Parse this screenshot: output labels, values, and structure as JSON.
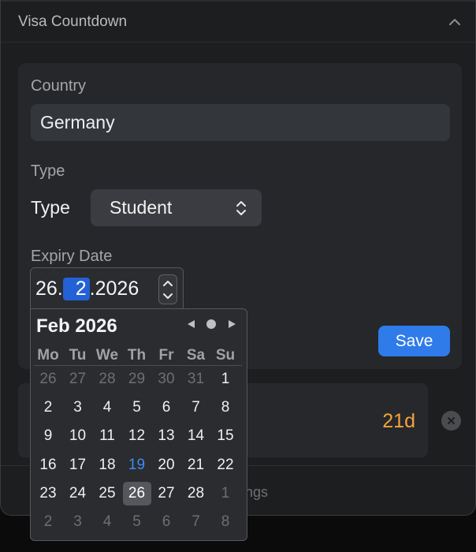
{
  "header": {
    "title": "Visa Countdown"
  },
  "form": {
    "country_label": "Country",
    "country_value": "Germany",
    "type_label": "Type",
    "type_inline_label": "Type",
    "type_value": "Student",
    "expiry_label": "Expiry Date",
    "date": {
      "day": "26.",
      "month": "2",
      "year": ".2026"
    },
    "save_label": "Save"
  },
  "calendar": {
    "title": "Feb 2026",
    "weekdays": [
      "Mo",
      "Tu",
      "We",
      "Th",
      "Fr",
      "Sa",
      "Su"
    ],
    "weeks": [
      [
        {
          "d": "26",
          "k": "dim"
        },
        {
          "d": "27",
          "k": "dim"
        },
        {
          "d": "28",
          "k": "dim"
        },
        {
          "d": "29",
          "k": "dim"
        },
        {
          "d": "30",
          "k": "dim"
        },
        {
          "d": "31",
          "k": "dim"
        },
        {
          "d": "1",
          "k": "norm"
        }
      ],
      [
        {
          "d": "2",
          "k": "norm"
        },
        {
          "d": "3",
          "k": "norm"
        },
        {
          "d": "4",
          "k": "norm"
        },
        {
          "d": "5",
          "k": "norm"
        },
        {
          "d": "6",
          "k": "norm"
        },
        {
          "d": "7",
          "k": "norm"
        },
        {
          "d": "8",
          "k": "norm"
        }
      ],
      [
        {
          "d": "9",
          "k": "norm"
        },
        {
          "d": "10",
          "k": "norm"
        },
        {
          "d": "11",
          "k": "norm"
        },
        {
          "d": "12",
          "k": "norm"
        },
        {
          "d": "13",
          "k": "norm"
        },
        {
          "d": "14",
          "k": "norm"
        },
        {
          "d": "15",
          "k": "norm"
        }
      ],
      [
        {
          "d": "16",
          "k": "norm"
        },
        {
          "d": "17",
          "k": "norm"
        },
        {
          "d": "18",
          "k": "norm"
        },
        {
          "d": "19",
          "k": "today"
        },
        {
          "d": "20",
          "k": "norm"
        },
        {
          "d": "21",
          "k": "norm"
        },
        {
          "d": "22",
          "k": "norm"
        }
      ],
      [
        {
          "d": "23",
          "k": "norm"
        },
        {
          "d": "24",
          "k": "norm"
        },
        {
          "d": "25",
          "k": "norm"
        },
        {
          "d": "26",
          "k": "sel-day"
        },
        {
          "d": "27",
          "k": "norm"
        },
        {
          "d": "28",
          "k": "norm"
        },
        {
          "d": "1",
          "k": "dim"
        }
      ],
      [
        {
          "d": "2",
          "k": "dim"
        },
        {
          "d": "3",
          "k": "dim"
        },
        {
          "d": "4",
          "k": "dim"
        },
        {
          "d": "5",
          "k": "dim"
        },
        {
          "d": "6",
          "k": "dim"
        },
        {
          "d": "7",
          "k": "dim"
        },
        {
          "d": "8",
          "k": "dim"
        }
      ]
    ]
  },
  "entry": {
    "days_left": "21d"
  },
  "footer": {
    "settings_partial": "ngs"
  },
  "colors": {
    "accent": "#2f7bea",
    "days_left": "#f5a33a",
    "today": "#3d8bf2"
  }
}
